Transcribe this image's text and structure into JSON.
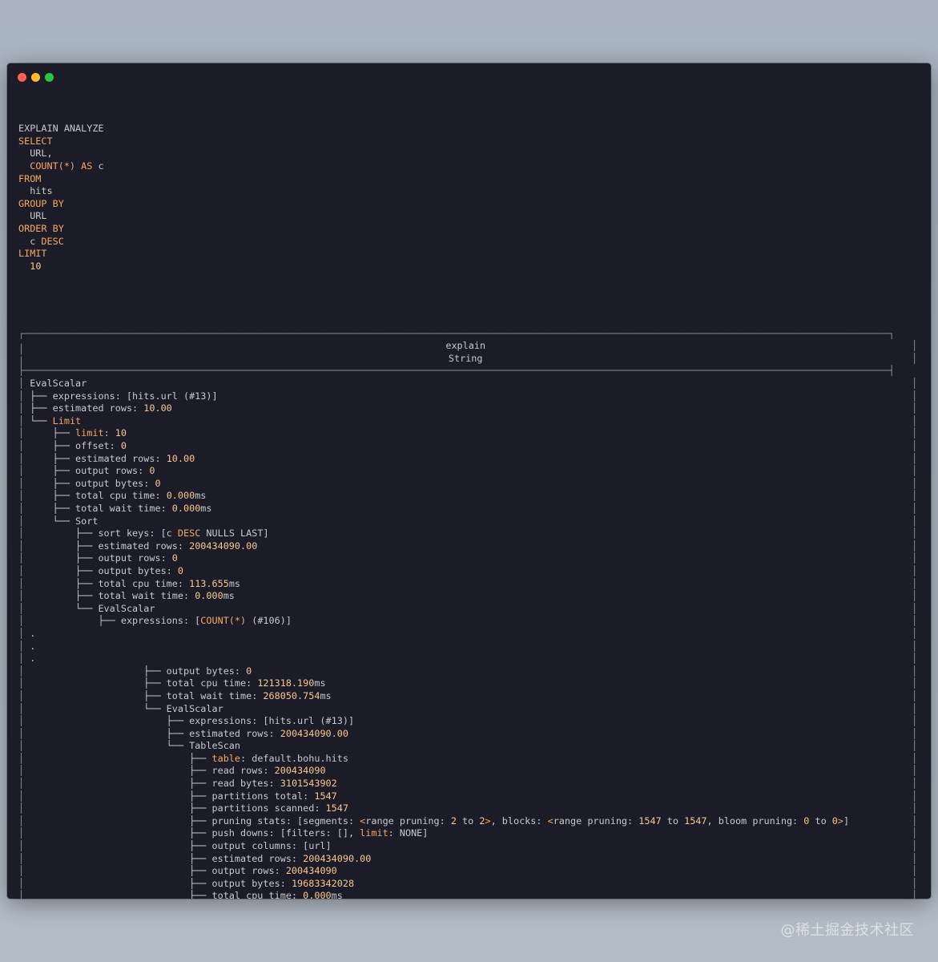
{
  "window": {
    "controls": [
      "close",
      "minimize",
      "zoom"
    ]
  },
  "query_lines": [
    [
      [
        "t",
        "EXPLAIN ANALYZE"
      ]
    ],
    [
      [
        "k",
        "SELECT"
      ]
    ],
    [
      [
        "t",
        "  URL,"
      ]
    ],
    [
      [
        "t",
        "  "
      ],
      [
        "k",
        "COUNT(*)"
      ],
      [
        "t",
        " "
      ],
      [
        "k",
        "AS"
      ],
      [
        "t",
        " c"
      ]
    ],
    [
      [
        "k",
        "FROM"
      ]
    ],
    [
      [
        "t",
        "  hits"
      ]
    ],
    [
      [
        "k",
        "GROUP BY"
      ]
    ],
    [
      [
        "t",
        "  URL"
      ]
    ],
    [
      [
        "k",
        "ORDER BY"
      ]
    ],
    [
      [
        "t",
        "  c "
      ],
      [
        "k",
        "DESC"
      ]
    ],
    [
      [
        "k",
        "LIMIT"
      ]
    ],
    [
      [
        "t",
        "  "
      ],
      [
        "n",
        "10"
      ]
    ]
  ],
  "result_lines": [
    [
      [
        "b",
        "┌────────────────────────────────────────────────────────────────────────────────────────────────────────────────────────────────────────────────────────┐"
      ]
    ],
    [
      [
        "b",
        "│"
      ],
      [
        "t",
        "                                                                          explain                                                                           "
      ],
      [
        "b",
        "│"
      ]
    ],
    [
      [
        "b",
        "│"
      ],
      [
        "t",
        "                                                                          String                                                                            "
      ],
      [
        "b",
        "│"
      ]
    ],
    [
      [
        "b",
        "├────────────────────────────────────────────────────────────────────────────────────────────────────────────────────────────────────────────────────────┤"
      ]
    ],
    [
      [
        "b",
        "│ "
      ],
      [
        "t",
        "EvalScalar"
      ]
    ],
    [
      [
        "b",
        "│ "
      ],
      [
        "t",
        "├── expressions: [hits.url (#13)]"
      ]
    ],
    [
      [
        "b",
        "│ "
      ],
      [
        "t",
        "├── estimated rows: "
      ],
      [
        "n",
        "10.00"
      ]
    ],
    [
      [
        "b",
        "│ "
      ],
      [
        "t",
        "└── "
      ],
      [
        "k",
        "Limit"
      ]
    ],
    [
      [
        "b",
        "│ "
      ],
      [
        "t",
        "    ├── "
      ],
      [
        "k",
        "limit"
      ],
      [
        "t",
        ": "
      ],
      [
        "n",
        "10"
      ]
    ],
    [
      [
        "b",
        "│ "
      ],
      [
        "t",
        "    ├── offset: "
      ],
      [
        "n",
        "0"
      ]
    ],
    [
      [
        "b",
        "│ "
      ],
      [
        "t",
        "    ├── estimated rows: "
      ],
      [
        "n",
        "10.00"
      ]
    ],
    [
      [
        "b",
        "│ "
      ],
      [
        "t",
        "    ├── output rows: "
      ],
      [
        "n",
        "0"
      ]
    ],
    [
      [
        "b",
        "│ "
      ],
      [
        "t",
        "    ├── output bytes: "
      ],
      [
        "n",
        "0"
      ]
    ],
    [
      [
        "b",
        "│ "
      ],
      [
        "t",
        "    ├── total cpu time: "
      ],
      [
        "n",
        "0.000"
      ],
      [
        "t",
        "ms"
      ]
    ],
    [
      [
        "b",
        "│ "
      ],
      [
        "t",
        "    ├── total wait time: "
      ],
      [
        "n",
        "0.000"
      ],
      [
        "t",
        "ms"
      ]
    ],
    [
      [
        "b",
        "│ "
      ],
      [
        "t",
        "    └── Sort"
      ]
    ],
    [
      [
        "b",
        "│ "
      ],
      [
        "t",
        "        ├── sort keys: [c "
      ],
      [
        "k",
        "DESC"
      ],
      [
        "t",
        " NULLS LAST]"
      ]
    ],
    [
      [
        "b",
        "│ "
      ],
      [
        "t",
        "        ├── estimated rows: "
      ],
      [
        "n",
        "200434090.00"
      ]
    ],
    [
      [
        "b",
        "│ "
      ],
      [
        "t",
        "        ├── output rows: "
      ],
      [
        "n",
        "0"
      ]
    ],
    [
      [
        "b",
        "│ "
      ],
      [
        "t",
        "        ├── output bytes: "
      ],
      [
        "n",
        "0"
      ]
    ],
    [
      [
        "b",
        "│ "
      ],
      [
        "t",
        "        ├── total cpu time: "
      ],
      [
        "n",
        "113.655"
      ],
      [
        "t",
        "ms"
      ]
    ],
    [
      [
        "b",
        "│ "
      ],
      [
        "t",
        "        ├── total wait time: "
      ],
      [
        "n",
        "0.000"
      ],
      [
        "t",
        "ms"
      ]
    ],
    [
      [
        "b",
        "│ "
      ],
      [
        "t",
        "        └── EvalScalar"
      ]
    ],
    [
      [
        "b",
        "│ "
      ],
      [
        "t",
        "            ├── expressions: ["
      ],
      [
        "k",
        "COUNT(*)"
      ],
      [
        "t",
        " (#106)]"
      ]
    ],
    [
      [
        "b",
        "│ "
      ],
      [
        "t",
        "."
      ]
    ],
    [
      [
        "b",
        "│ "
      ],
      [
        "t",
        "."
      ]
    ],
    [
      [
        "b",
        "│ "
      ],
      [
        "t",
        "."
      ]
    ],
    [
      [
        "b",
        "│ "
      ],
      [
        "t",
        "                    ├── output bytes: "
      ],
      [
        "n",
        "0"
      ]
    ],
    [
      [
        "b",
        "│ "
      ],
      [
        "t",
        "                    ├── total cpu time: "
      ],
      [
        "n",
        "121318.190"
      ],
      [
        "t",
        "ms"
      ]
    ],
    [
      [
        "b",
        "│ "
      ],
      [
        "t",
        "                    ├── total wait time: "
      ],
      [
        "n",
        "268050.754"
      ],
      [
        "t",
        "ms"
      ]
    ],
    [
      [
        "b",
        "│ "
      ],
      [
        "t",
        "                    └── EvalScalar"
      ]
    ],
    [
      [
        "b",
        "│ "
      ],
      [
        "t",
        "                        ├── expressions: [hits.url (#13)]"
      ]
    ],
    [
      [
        "b",
        "│ "
      ],
      [
        "t",
        "                        ├── estimated rows: "
      ],
      [
        "n",
        "200434090.00"
      ]
    ],
    [
      [
        "b",
        "│ "
      ],
      [
        "t",
        "                        └── TableScan"
      ]
    ],
    [
      [
        "b",
        "│ "
      ],
      [
        "t",
        "                            ├── "
      ],
      [
        "k",
        "table"
      ],
      [
        "t",
        ": default.bohu.hits"
      ]
    ],
    [
      [
        "b",
        "│ "
      ],
      [
        "t",
        "                            ├── read rows: "
      ],
      [
        "n",
        "200434090"
      ]
    ],
    [
      [
        "b",
        "│ "
      ],
      [
        "t",
        "                            ├── read bytes: "
      ],
      [
        "n",
        "3101543902"
      ]
    ],
    [
      [
        "b",
        "│ "
      ],
      [
        "t",
        "                            ├── partitions total: "
      ],
      [
        "n",
        "1547"
      ]
    ],
    [
      [
        "b",
        "│ "
      ],
      [
        "t",
        "                            ├── partitions scanned: "
      ],
      [
        "n",
        "1547"
      ]
    ],
    [
      [
        "b",
        "│ "
      ],
      [
        "t",
        "                            ├── pruning stats: [segments: "
      ],
      [
        "k",
        "<"
      ],
      [
        "t",
        "range pruning: "
      ],
      [
        "n",
        "2"
      ],
      [
        "t",
        " to "
      ],
      [
        "n",
        "2"
      ],
      [
        "k",
        ">"
      ],
      [
        "t",
        ", blocks: "
      ],
      [
        "k",
        "<"
      ],
      [
        "t",
        "range pruning: "
      ],
      [
        "n",
        "1547"
      ],
      [
        "t",
        " to "
      ],
      [
        "n",
        "1547"
      ],
      [
        "t",
        ", bloom pruning: "
      ],
      [
        "n",
        "0"
      ],
      [
        "t",
        " to "
      ],
      [
        "n",
        "0"
      ],
      [
        "k",
        ">"
      ],
      [
        "t",
        "]"
      ]
    ],
    [
      [
        "b",
        "│ "
      ],
      [
        "t",
        "                            ├── push downs: [filters: [], "
      ],
      [
        "k",
        "limit"
      ],
      [
        "t",
        ": NONE]"
      ]
    ],
    [
      [
        "b",
        "│ "
      ],
      [
        "t",
        "                            ├── output columns: [url]"
      ]
    ],
    [
      [
        "b",
        "│ "
      ],
      [
        "t",
        "                            ├── estimated rows: "
      ],
      [
        "n",
        "200434090.00"
      ]
    ],
    [
      [
        "b",
        "│ "
      ],
      [
        "t",
        "                            ├── output rows: "
      ],
      [
        "n",
        "200434090"
      ]
    ],
    [
      [
        "b",
        "│ "
      ],
      [
        "t",
        "                            ├── output bytes: "
      ],
      [
        "n",
        "19683342028"
      ]
    ],
    [
      [
        "b",
        "│ "
      ],
      [
        "t",
        "                            ├── total cpu time: "
      ],
      [
        "n",
        "0.000"
      ],
      [
        "t",
        "ms"
      ]
    ],
    [
      [
        "b",
        "│ "
      ],
      [
        "t",
        "                            └── total wait time: "
      ],
      [
        "n",
        "436475.663"
      ],
      [
        "t",
        "ms"
      ]
    ],
    [
      [
        "b",
        "│ "
      ],
      [
        "n",
        "58"
      ],
      [
        "t",
        " rows"
      ]
    ],
    [
      [
        "b",
        "│ "
      ],
      [
        "t",
        "("
      ],
      [
        "n",
        "40"
      ],
      [
        "t",
        " shown)"
      ]
    ],
    [
      [
        "b",
        "└────────────────────────────────────────────────────────────────────────────────────────────────────────────────────────────────────────────────────────┘"
      ]
    ]
  ],
  "watermark": "@稀土掘金技术社区",
  "colors": {
    "keyword": "#f6a865",
    "number": "#f9c88f",
    "text": "#c8c8d0",
    "background": "#1c1c28"
  }
}
